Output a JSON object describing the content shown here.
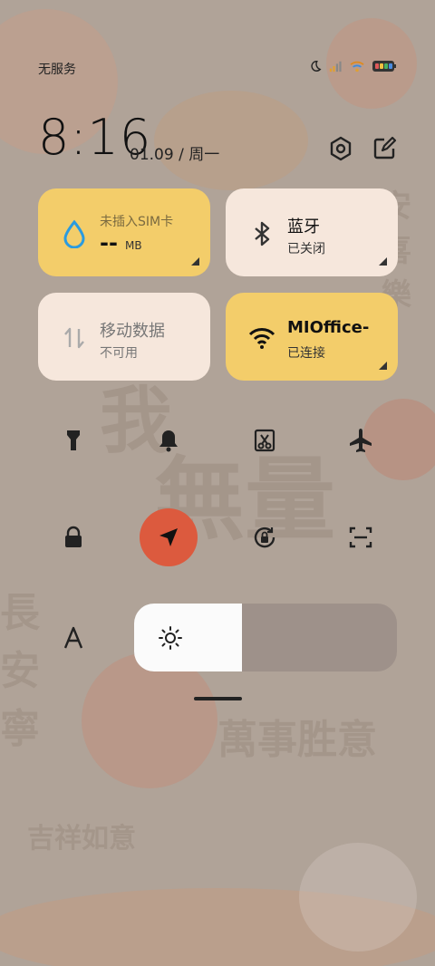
{
  "status_bar": {
    "carrier": "无服务",
    "icons": [
      "moon-icon",
      "signal-icon",
      "wifi-icon",
      "battery-icon"
    ]
  },
  "header": {
    "time": "8:16",
    "date": "01.09 / 周一",
    "settings_icon": "gear-icon",
    "edit_icon": "edit-icon"
  },
  "tiles": {
    "data_usage": {
      "title": "未插入SIM卡",
      "value": "--",
      "unit": "MB",
      "icon": "drop-icon"
    },
    "bluetooth": {
      "title": "蓝牙",
      "status": "已关闭",
      "icon": "bluetooth-icon"
    },
    "mobile_data": {
      "title": "移动数据",
      "status": "不可用",
      "icon": "updown-arrows-icon"
    },
    "wifi": {
      "title": "MIOffice-",
      "status": "已连接",
      "icon": "wifi-icon"
    }
  },
  "toggles_row1": [
    "flashlight-icon",
    "bell-icon",
    "screenshot-icon",
    "airplane-icon"
  ],
  "toggles_row2": [
    "lock-icon",
    "location-icon",
    "rotation-lock-icon",
    "scan-icon"
  ],
  "brightness": {
    "level": 0.41,
    "icon": "sun-icon"
  },
  "font_size_icon": "font-icon",
  "colors": {
    "yellow_tile": "#f3cd6a",
    "cream_tile": "#f6e7dc",
    "active_toggle": "#dc5a3e",
    "drop_icon": "#2a9be0"
  }
}
